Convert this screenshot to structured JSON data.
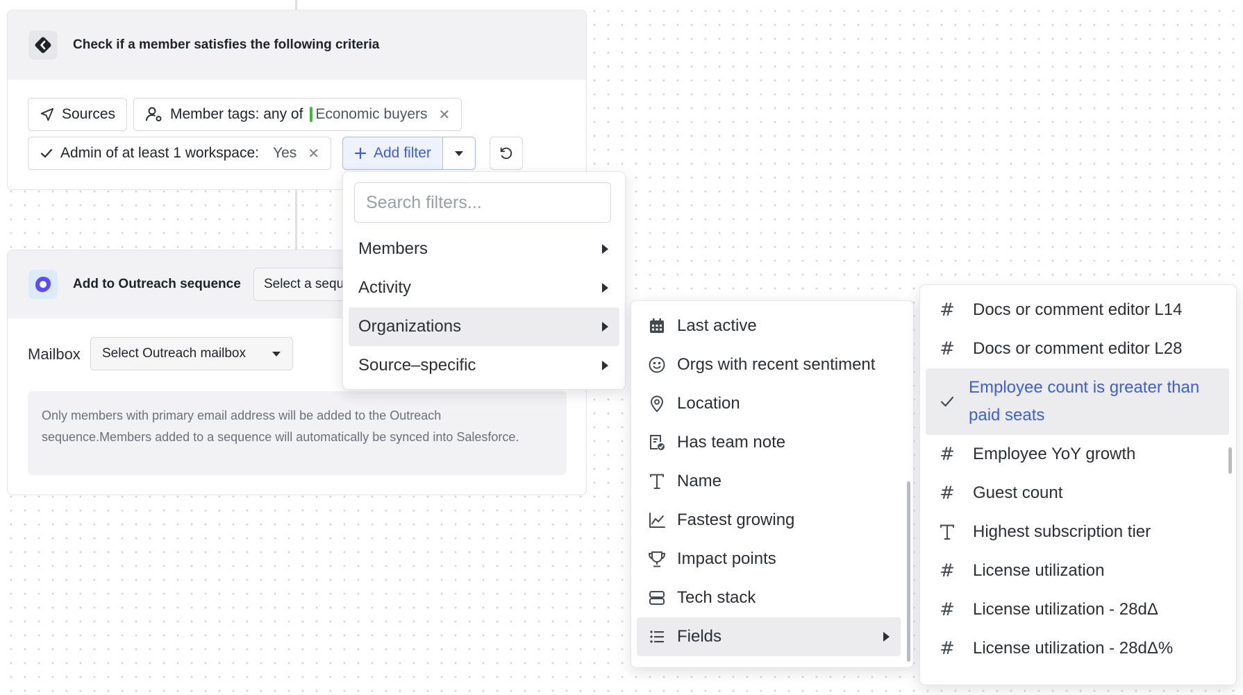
{
  "workflow": {
    "criteria_step": {
      "title": "Check if a member satisfies the following criteria",
      "filters": {
        "sources_label": "Sources",
        "member_tags_label": "Member tags: any of",
        "member_tags_value": "Economic buyers",
        "admin_label": "Admin of at least 1 workspace:",
        "admin_value": "Yes",
        "add_filter_label": "Add filter"
      }
    },
    "outreach_step": {
      "title": "Add to Outreach sequence",
      "sequence_select": "Select a sequence",
      "mailbox_label": "Mailbox",
      "mailbox_select": "Select Outreach mailbox",
      "note": "Only members with primary email address will be added to the Outreach sequence.Members added to a sequence will automatically be synced into Salesforce."
    }
  },
  "filter_menu": {
    "search_placeholder": "Search filters...",
    "items": [
      {
        "label": "Members"
      },
      {
        "label": "Activity"
      },
      {
        "label": "Organizations",
        "active": true
      },
      {
        "label": "Source–specific"
      }
    ]
  },
  "org_submenu": {
    "items": [
      {
        "label": "Last active",
        "icon": "calendar-icon"
      },
      {
        "label": "Orgs with recent sentiment",
        "icon": "smiley-icon"
      },
      {
        "label": "Location",
        "icon": "map-pin-icon"
      },
      {
        "label": "Has team note",
        "icon": "note-check-icon"
      },
      {
        "label": "Name",
        "icon": "text-icon"
      },
      {
        "label": "Fastest growing",
        "icon": "line-chart-icon"
      },
      {
        "label": "Impact points",
        "icon": "trophy-icon"
      },
      {
        "label": "Tech stack",
        "icon": "server-icon"
      },
      {
        "label": "Fields",
        "icon": "list-icon",
        "active": true
      }
    ]
  },
  "fields_submenu": {
    "items": [
      {
        "label": "Docs or comment editor L14",
        "icon": "hash-icon"
      },
      {
        "label": "Docs or comment editor L28",
        "icon": "hash-icon"
      },
      {
        "label": "Employee count is greater than paid seats",
        "icon": "check-icon",
        "selected": true
      },
      {
        "label": "Employee YoY growth",
        "icon": "hash-icon"
      },
      {
        "label": "Guest count",
        "icon": "hash-icon"
      },
      {
        "label": "Highest subscription tier",
        "icon": "text-icon"
      },
      {
        "label": "License utilization",
        "icon": "hash-icon"
      },
      {
        "label": "License utilization - 28dΔ",
        "icon": "hash-icon"
      },
      {
        "label": "License utilization - 28dΔ%",
        "icon": "hash-icon"
      }
    ]
  },
  "colors": {
    "accent": "#3d5ed9",
    "tag_green": "#3bbd3b",
    "outreach_purple": "#5b4bff"
  }
}
